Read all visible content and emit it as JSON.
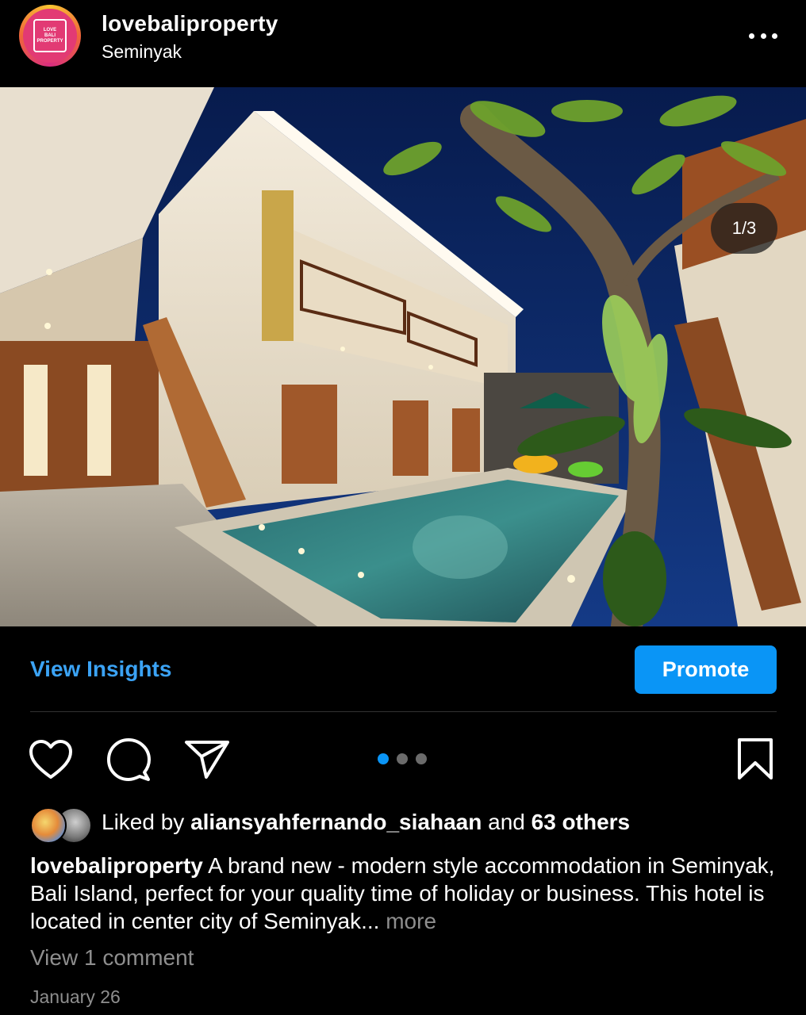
{
  "post": {
    "username": "lovebaliproperty",
    "location": "Seminyak",
    "avatar_text": [
      "LOVE",
      "BALI",
      "PROPERTY"
    ],
    "image_counter": "1/3",
    "image_description": "Two-story modern villa with swimming pool at night in Seminyak"
  },
  "actions": {
    "view_insights": "View Insights",
    "promote": "Promote",
    "carousel_total": 3,
    "carousel_active": 1
  },
  "likes": {
    "prefix": "Liked by ",
    "user": "aliansyahfernando_siahaan",
    "middle": " and ",
    "others": "63 others"
  },
  "caption": {
    "username": "lovebaliproperty",
    "text": " A brand new - modern style accommodation in Seminyak, Bali Island, perfect for your quality time of holiday or business. This hotel is located in center city of Seminyak... ",
    "more": "more"
  },
  "comments_link": "View 1 comment",
  "date": "January 26",
  "colors": {
    "accent": "#0a95f6",
    "link": "#3ba3f5",
    "muted": "#8e8e8e",
    "background": "#000000"
  }
}
